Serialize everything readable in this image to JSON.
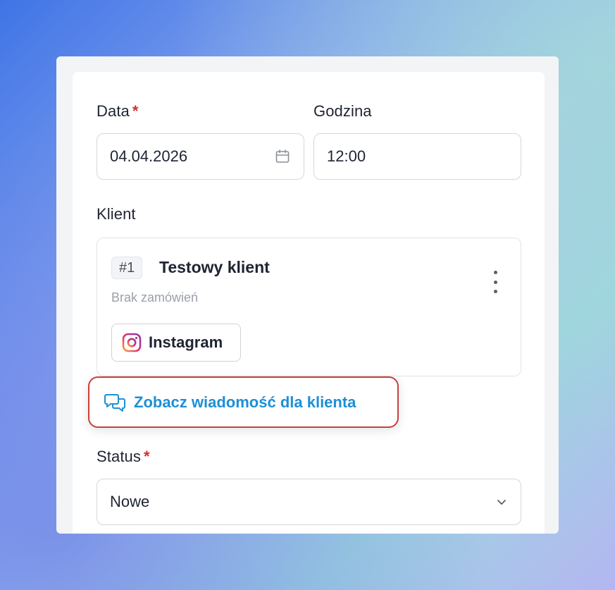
{
  "form": {
    "date": {
      "label": "Data",
      "required_mark": "*",
      "value": "04.04.2026"
    },
    "time": {
      "label": "Godzina",
      "value": "12:00"
    },
    "client": {
      "label": "Klient",
      "id": "#1",
      "name": "Testowy klient",
      "subtitle": "Brak zamówień",
      "channel": "Instagram"
    },
    "message_link": "Zobacz wiadomość dla klienta",
    "status": {
      "label": "Status",
      "required_mark": "*",
      "value": "Nowe"
    }
  },
  "colors": {
    "accent_link": "#1d8fd6",
    "highlight_border": "#c9403a",
    "required": "#d32f2f"
  },
  "icons": [
    "calendar-icon",
    "more-vertical-icon",
    "instagram-icon",
    "chat-bubbles-icon",
    "chevron-down-icon"
  ]
}
